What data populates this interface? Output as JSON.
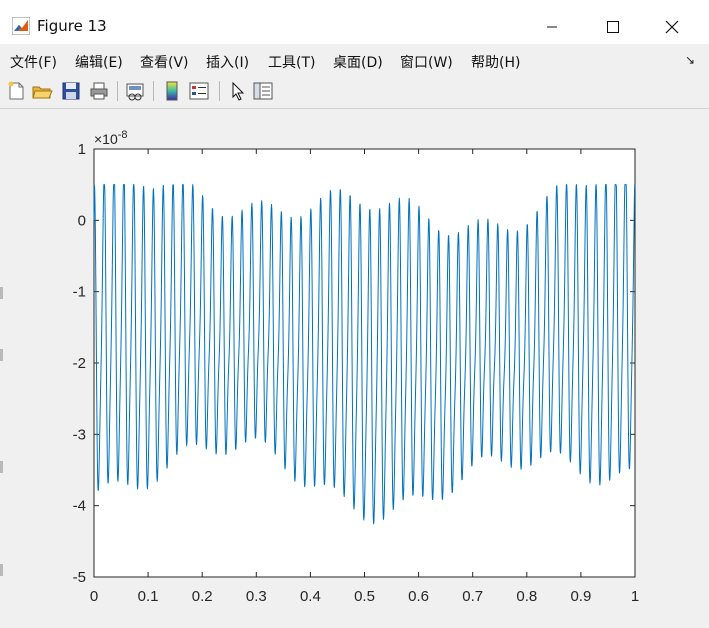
{
  "window": {
    "title": "Figure 13"
  },
  "menu": {
    "items": [
      {
        "label": "文件(F)"
      },
      {
        "label": "编辑(E)"
      },
      {
        "label": "查看(V)"
      },
      {
        "label": "插入(I)"
      },
      {
        "label": "工具(T)"
      },
      {
        "label": "桌面(D)"
      },
      {
        "label": "窗口(W)"
      },
      {
        "label": "帮助(H)"
      }
    ]
  },
  "toolbar": {
    "icons": [
      "new-figure-icon",
      "open-file-icon",
      "save-icon",
      "print-icon",
      "link-plot-icon",
      "insert-colorbar-icon",
      "insert-legend-icon",
      "edit-plot-arrow-icon",
      "property-inspector-icon"
    ]
  },
  "chart_data": {
    "type": "line",
    "title": "",
    "xlabel": "",
    "ylabel": "",
    "y_exponent_label": "×10",
    "y_exponent_power": "-8",
    "xlim": [
      0,
      1
    ],
    "ylim": [
      -5,
      1
    ],
    "x_ticks": [
      "0",
      "0.1",
      "0.2",
      "0.3",
      "0.4",
      "0.5",
      "0.6",
      "0.7",
      "0.8",
      "0.9",
      "1"
    ],
    "y_ticks": [
      "1",
      "0",
      "-1",
      "-2",
      "-3",
      "-4",
      "-5"
    ],
    "grid": false,
    "line_color": "#0072bd",
    "series": [
      {
        "x": [
          0,
          0.1,
          0.2,
          0.3,
          0.4,
          0.5,
          0.6,
          0.7,
          0.8,
          0.9,
          1
        ],
        "y": [
          0,
          -0.9,
          -1.1,
          -0.8,
          -0.3,
          -0.2,
          -0.5,
          -0.9,
          -1.0,
          -0.6,
          -1.4
        ],
        "peaks_approx": [
          0.4,
          -0.2,
          0.1,
          0.5,
          0.3,
          0.3,
          -0.1,
          0.2,
          0.3,
          0.0
        ]
      }
    ],
    "oscillation_frequency_hz": 55,
    "envelope": {
      "max": 0.5,
      "min": -4.55,
      "mean": -1.8
    }
  },
  "colors": {
    "window_bg": "#f0f0f0",
    "axes_bg": "#ffffff",
    "line": "#0072bd",
    "axis": "#262626"
  }
}
